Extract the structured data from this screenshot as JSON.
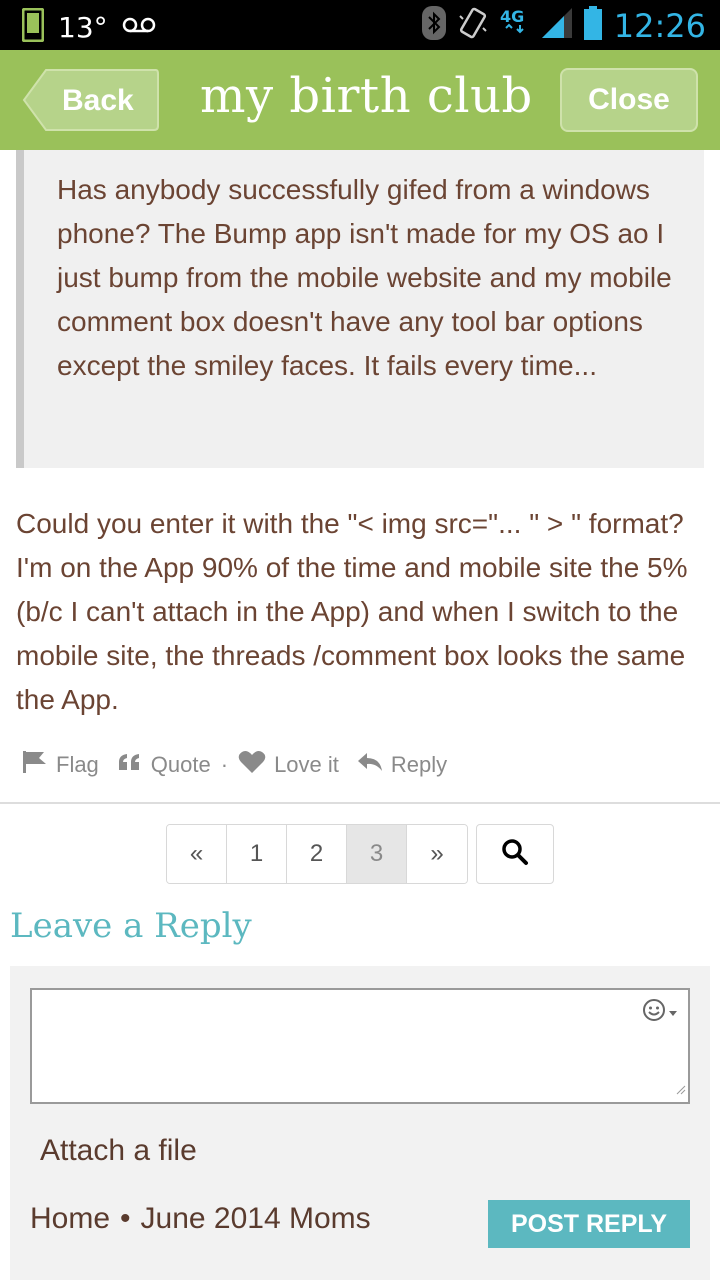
{
  "status_bar": {
    "temperature": "13°",
    "network": "4G",
    "time": "12:26"
  },
  "header": {
    "back_label": "Back",
    "title": "my birth club",
    "close_label": "Close"
  },
  "quote": {
    "text": "Has anybody successfully gifed from a windows phone? The Bump app isn't made for my OS ao I just bump from the mobile website and my mobile comment box doesn't  have any tool bar options except the smiley faces. It fails every time..."
  },
  "post": {
    "body": "Could you enter it with the \"< img src=\"... \" > \" format? I'm on the App 90% of the time and mobile site the 5% (b/c I can't attach in the App) and when I switch to the mobile site, the threads /comment box looks the same the App."
  },
  "actions": {
    "flag": "Flag",
    "quote": "Quote",
    "separator": "·",
    "love": "Love it",
    "reply": "Reply"
  },
  "pagination": {
    "prev": "«",
    "pages": [
      "1",
      "2",
      "3"
    ],
    "active_page": "3",
    "next": "»"
  },
  "reply_form": {
    "heading": "Leave a Reply",
    "attach": "Attach a file",
    "breadcrumb_home": "Home",
    "breadcrumb_sep": "•",
    "breadcrumb_group": "June 2014 Moms",
    "post_button": "POST REPLY"
  },
  "colors": {
    "header_green": "#9ac15a",
    "accent_teal": "#5cb8c0",
    "text_brown": "#6b4433",
    "status_blue": "#33b5e5"
  }
}
